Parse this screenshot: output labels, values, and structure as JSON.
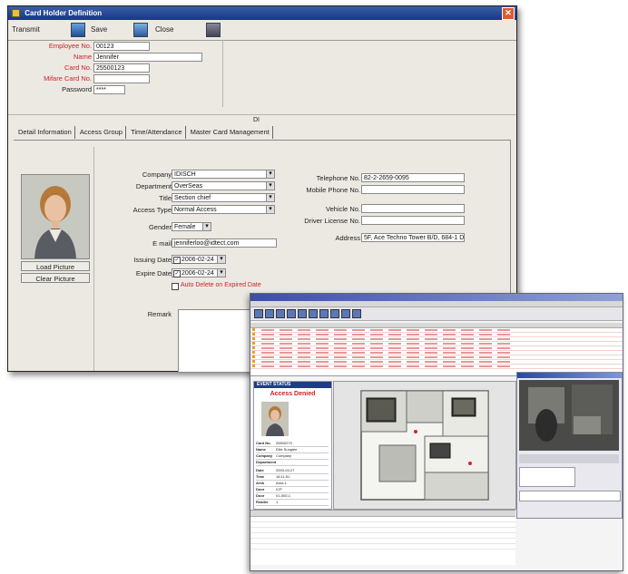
{
  "card_window": {
    "title": "Card Holder Definition",
    "toolbar": {
      "transmit_label": "Transmit",
      "save_label": "Save",
      "close_label": "Close"
    },
    "header": {
      "employee_no_label": "Employee No.",
      "employee_no_value": "00123",
      "name_label": "Name",
      "name_value": "Jennifer",
      "card_no_label": "Card No.",
      "card_no_value": "25500123",
      "mifare_label": "Mifare Card No.",
      "mifare_value": "",
      "password_label": "Password",
      "password_value": "****",
      "section_marker": "DI"
    },
    "tabs": [
      {
        "label": "Detail Information"
      },
      {
        "label": "Access Group"
      },
      {
        "label": "Time/Attendance"
      },
      {
        "label": "Master Card Management"
      }
    ],
    "detail": {
      "company_label": "Company",
      "company_value": "IDISCH",
      "department_label": "Department",
      "department_value": "OverSeas",
      "title_label": "Title",
      "title_value": "Section chief",
      "access_type_label": "Access Type",
      "access_type_value": "Normal Access",
      "gender_label": "Gender",
      "gender_value": "Female",
      "email_label": "E mail",
      "email_value": "jenniferloo@idtect.com",
      "issuing_date_label": "Issuing Date",
      "issuing_date_value": "2006-02-24",
      "expire_date_label": "Expire Date",
      "expire_date_value": "2006-02-24",
      "auto_delete_label": "Auto Delete on Expired Date",
      "remark_label": "Remark",
      "telephone_label": "Telephone No.",
      "telephone_value": "82-2-2659-0095",
      "mobile_label": "Mobile Phone No.",
      "mobile_value": "",
      "vehicle_label": "Vehicle No.",
      "vehicle_value": "",
      "driver_label": "Driver License No.",
      "driver_value": "",
      "address_label": "Address",
      "address_value": "5F, Ace Techno Tower B/D, 684-1 Dei"
    },
    "buttons": {
      "load_picture": "Load Picture",
      "clear_picture": "Clear Picture"
    }
  },
  "monitor_window": {
    "event_status_title": "EVENT STATUS",
    "access_status": "Access Denied",
    "status_rows": [
      {
        "k": "Card No.",
        "v": "25500270"
      },
      {
        "k": "Name",
        "v": "Ellie Sunglee"
      },
      {
        "k": "Company",
        "v": "Company"
      },
      {
        "k": "Department",
        "v": ""
      },
      {
        "k": "Date",
        "v": "2003-04-27"
      },
      {
        "k": "Time",
        "v": "16:11:51"
      },
      {
        "k": "Area",
        "v": "Area 1"
      },
      {
        "k": "Door",
        "v": "ICP"
      },
      {
        "k": "Door",
        "v": "01-000-1"
      },
      {
        "k": "Reader",
        "v": "1"
      }
    ]
  },
  "colors": {
    "accent_title": "#17368a",
    "denied_red": "#d02020",
    "label_red": "#c8232a"
  }
}
